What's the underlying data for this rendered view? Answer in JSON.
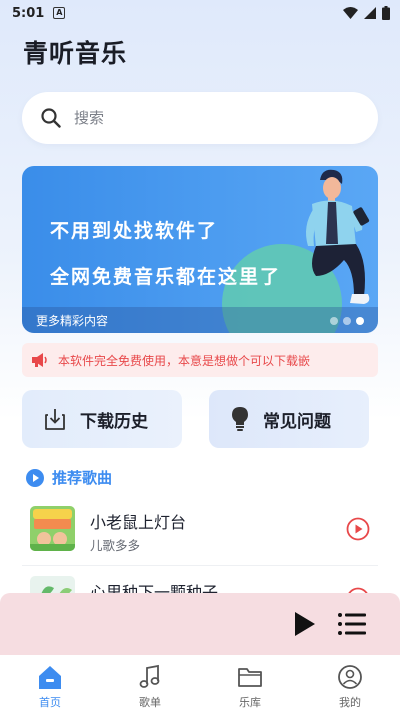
{
  "status_bar": {
    "time": "5:01",
    "notification_glyph": "A"
  },
  "app": {
    "title": "青听音乐"
  },
  "search": {
    "placeholder": "搜索"
  },
  "banner": {
    "line1": "不用到处找软件了",
    "line2": "全网免费音乐都在这里了",
    "more": "更多精彩内容",
    "page_count": 3,
    "active_page": 3
  },
  "notice": {
    "text": "本软件完全免费使用，本意是想做个可以下载嵌"
  },
  "quick_actions": {
    "history_label": "下载历史",
    "faq_label": "常见问题"
  },
  "recommend": {
    "title": "推荐歌曲"
  },
  "songs": [
    {
      "title": "小老鼠上灯台",
      "artist": "儿歌多多"
    },
    {
      "title": "心里种下一颗种子",
      "artist": ""
    }
  ],
  "tabs": [
    {
      "label": "首页",
      "active": true
    },
    {
      "label": "歌单",
      "active": false
    },
    {
      "label": "乐库",
      "active": false
    },
    {
      "label": "我的",
      "active": false
    }
  ],
  "colors": {
    "accent": "#3d8cf0",
    "notice_text": "#e8484a",
    "song_play": "#e8484a",
    "player_bg": "#f6dde1"
  }
}
